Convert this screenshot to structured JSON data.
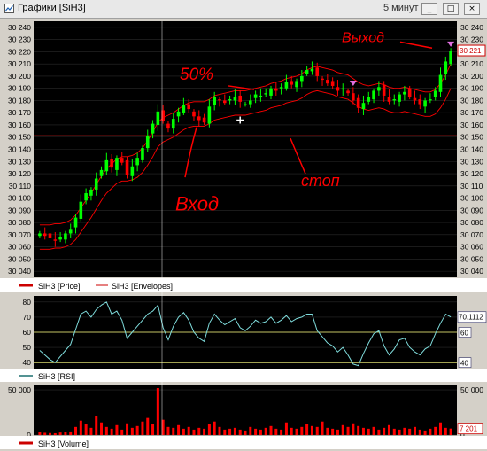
{
  "window": {
    "title": "Графики [SiH3]",
    "interval": "5 минут",
    "buttons": {
      "minimize": "_",
      "restore": "□",
      "close": "×"
    }
  },
  "colors": {
    "background": "#000000",
    "candle_up": "#00ff00",
    "candle_down": "#ff0000",
    "envelope": "#ff0000",
    "rsi_line": "#7fdcdc",
    "guide_line": "#ffff80",
    "volume": "#ff0000",
    "annotation": "#ff0000",
    "arrow_marker": "#e070e0",
    "cross_marker": "#ffffff"
  },
  "panels": {
    "price": {
      "legend": [
        "SiH3 [Price]",
        "SiH3 [Envelopes]"
      ],
      "last_value": "30 221"
    },
    "rsi": {
      "legend": [
        "SiH3 [RSI]"
      ],
      "last_value": "70.1112",
      "level_high": "60",
      "level_low": "40"
    },
    "volume": {
      "legend": [
        "SiH3 [Volume]"
      ],
      "last_value": "7 201"
    }
  },
  "annotations": [
    {
      "text": "Вход",
      "target": "entry candle near 30 155"
    },
    {
      "text": "50%",
      "target": "price near 30 190"
    },
    {
      "text": "стоп",
      "target": "horizontal level 30 150"
    },
    {
      "text": "Выход",
      "target": "exit near 30 220"
    }
  ],
  "chart_data": [
    {
      "type": "candlestick",
      "title": "",
      "ylim": [
        30035,
        30245
      ],
      "yticks": [
        "30 040",
        "30 050",
        "30 060",
        "30 070",
        "30 080",
        "30 090",
        "30 100",
        "30 110",
        "30 120",
        "30 130",
        "30 140",
        "30 150",
        "30 160",
        "30 170",
        "30 180",
        "30 190",
        "30 200",
        "30 210",
        "30 220",
        "30 230",
        "30 240"
      ],
      "horizontal_line": 30151,
      "series": [
        {
          "name": "SiH3 [Price]",
          "close": [
            30071,
            30069,
            30067,
            30065,
            30068,
            30071,
            30074,
            30084,
            30097,
            30104,
            30107,
            30116,
            30123,
            30131,
            30125,
            30133,
            30129,
            30119,
            30126,
            30133,
            30141,
            30151,
            30161,
            30171,
            30163,
            30157,
            30165,
            30171,
            30176,
            30173,
            30167,
            30164,
            30162,
            30175,
            30183,
            30180,
            30178,
            30181,
            30183,
            30179,
            30177,
            30180,
            30185,
            30184,
            30186,
            30190,
            30188,
            30191,
            30195,
            30193,
            30196,
            30200,
            30205,
            30206,
            30200,
            30197,
            30194,
            30192,
            30188,
            30190,
            30186,
            30180,
            30174,
            30178,
            30183,
            30188,
            30191,
            30184,
            30179,
            30181,
            30185,
            30187,
            30183,
            30180,
            30177,
            30180,
            30181,
            30188,
            30201,
            30212,
            30221
          ]
        },
        {
          "name": "SiH3 [Envelopes]",
          "upper": [
            30078,
            30078,
            30078,
            30079,
            30079,
            30080,
            30082,
            30086,
            30092,
            30098,
            30104,
            30111,
            30118,
            30124,
            30128,
            30132,
            30134,
            30134,
            30135,
            30137,
            30141,
            30147,
            30154,
            30162,
            30166,
            30168,
            30170,
            30173,
            30176,
            30178,
            30179,
            30179,
            30179,
            30181,
            30184,
            30185,
            30186,
            30187,
            30188,
            30188,
            30188,
            30189,
            30190,
            30191,
            30192,
            30194,
            30195,
            30196,
            30198,
            30199,
            30200,
            30202,
            30205,
            30207,
            30208,
            30207,
            30206,
            30205,
            30203,
            30202,
            30201,
            30198,
            30195,
            30193,
            30192,
            30193,
            30194,
            30193,
            30191,
            30190,
            30190,
            30191,
            30190,
            30189,
            30188,
            30187,
            30187,
            30189,
            30194,
            30201,
            30210
          ],
          "lower": [
            30058,
            30058,
            30058,
            30059,
            30059,
            30060,
            30062,
            30066,
            30072,
            30078,
            30084,
            30091,
            30098,
            30104,
            30108,
            30112,
            30114,
            30114,
            30115,
            30117,
            30121,
            30127,
            30134,
            30142,
            30146,
            30148,
            30150,
            30153,
            30156,
            30158,
            30159,
            30159,
            30159,
            30161,
            30164,
            30165,
            30166,
            30167,
            30168,
            30168,
            30168,
            30169,
            30170,
            30171,
            30172,
            30174,
            30175,
            30176,
            30178,
            30179,
            30180,
            30182,
            30185,
            30187,
            30188,
            30187,
            30186,
            30185,
            30183,
            30182,
            30181,
            30178,
            30175,
            30173,
            30172,
            30173,
            30174,
            30173,
            30171,
            30170,
            30170,
            30171,
            30170,
            30169,
            30168,
            30167,
            30167,
            30169,
            30174,
            30181,
            30190
          ]
        }
      ]
    },
    {
      "type": "line",
      "ylim": [
        36,
        84
      ],
      "yticks": [
        "40",
        "50",
        "60",
        "70",
        "80"
      ],
      "levels": [
        60,
        40
      ],
      "series": [
        {
          "name": "SiH3 [RSI]",
          "values": [
            48,
            45,
            42,
            40,
            44,
            48,
            52,
            62,
            72,
            74,
            70,
            75,
            78,
            80,
            72,
            74,
            68,
            56,
            60,
            64,
            68,
            72,
            74,
            78,
            63,
            55,
            64,
            70,
            73,
            68,
            60,
            56,
            54,
            66,
            72,
            68,
            65,
            67,
            69,
            63,
            61,
            64,
            68,
            66,
            67,
            70,
            66,
            68,
            71,
            67,
            69,
            70,
            72,
            72,
            61,
            57,
            53,
            51,
            47,
            50,
            45,
            39,
            38,
            46,
            53,
            59,
            61,
            51,
            45,
            49,
            55,
            56,
            50,
            47,
            45,
            49,
            51,
            59,
            66,
            72,
            70.1
          ]
        }
      ]
    },
    {
      "type": "bar",
      "ylim": [
        0,
        55000
      ],
      "yticks": [
        "0",
        "50 000"
      ],
      "series": [
        {
          "name": "SiH3 [Volume]",
          "values": [
            3000,
            2500,
            2200,
            2000,
            2800,
            3500,
            4000,
            9000,
            16000,
            12000,
            8000,
            21000,
            14000,
            9000,
            7000,
            11000,
            6000,
            13000,
            8000,
            10000,
            15000,
            19000,
            12000,
            52000,
            17000,
            9000,
            8000,
            11000,
            7000,
            9000,
            6000,
            8000,
            7000,
            12000,
            15000,
            9000,
            6000,
            7000,
            8000,
            6000,
            5000,
            9000,
            7000,
            6000,
            8000,
            10000,
            7000,
            6000,
            14000,
            8000,
            7000,
            9000,
            12000,
            10000,
            9000,
            15000,
            8000,
            7000,
            6000,
            11000,
            9000,
            13000,
            10000,
            8000,
            7000,
            9000,
            6000,
            8000,
            11000,
            7000,
            6000,
            8000,
            7000,
            9000,
            6000,
            5000,
            7000,
            9000,
            14000,
            8000,
            7201
          ]
        }
      ]
    }
  ]
}
